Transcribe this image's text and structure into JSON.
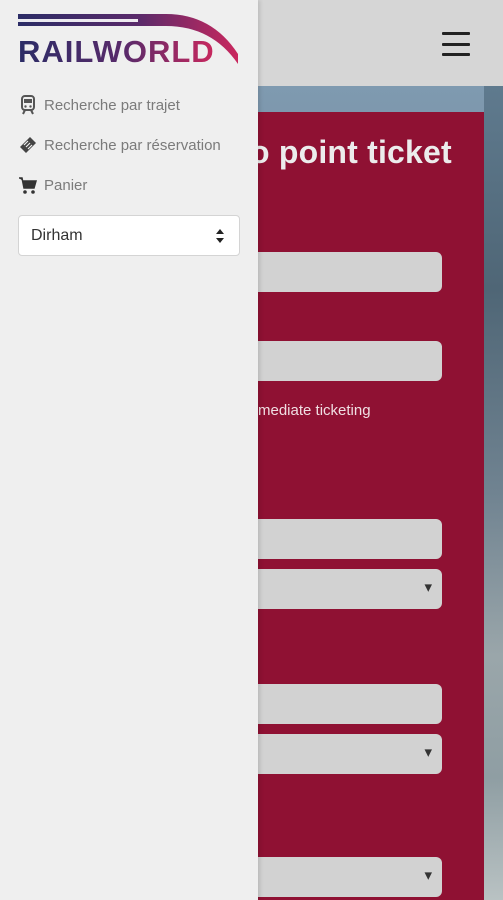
{
  "brand": {
    "logo_text": "RAILWORLD"
  },
  "drawer": {
    "nav": [
      {
        "label": "Recherche par trajet",
        "icon": "train-icon"
      },
      {
        "label": "Recherche par réservation",
        "icon": "ticket-icon"
      },
      {
        "label": "Panier",
        "icon": "cart-icon"
      }
    ],
    "currency": {
      "selected": "Dirham"
    }
  },
  "background_page": {
    "panel_title_partial": "o point ticket",
    "ticketing_note_partial": "mediate ticketing"
  },
  "colors": {
    "panel": "#8f1133",
    "drawer_bg": "#efefef",
    "topbar_bg": "#d6d6d6",
    "logo_navy": "#2b2c66",
    "logo_magenta": "#c9285e"
  }
}
